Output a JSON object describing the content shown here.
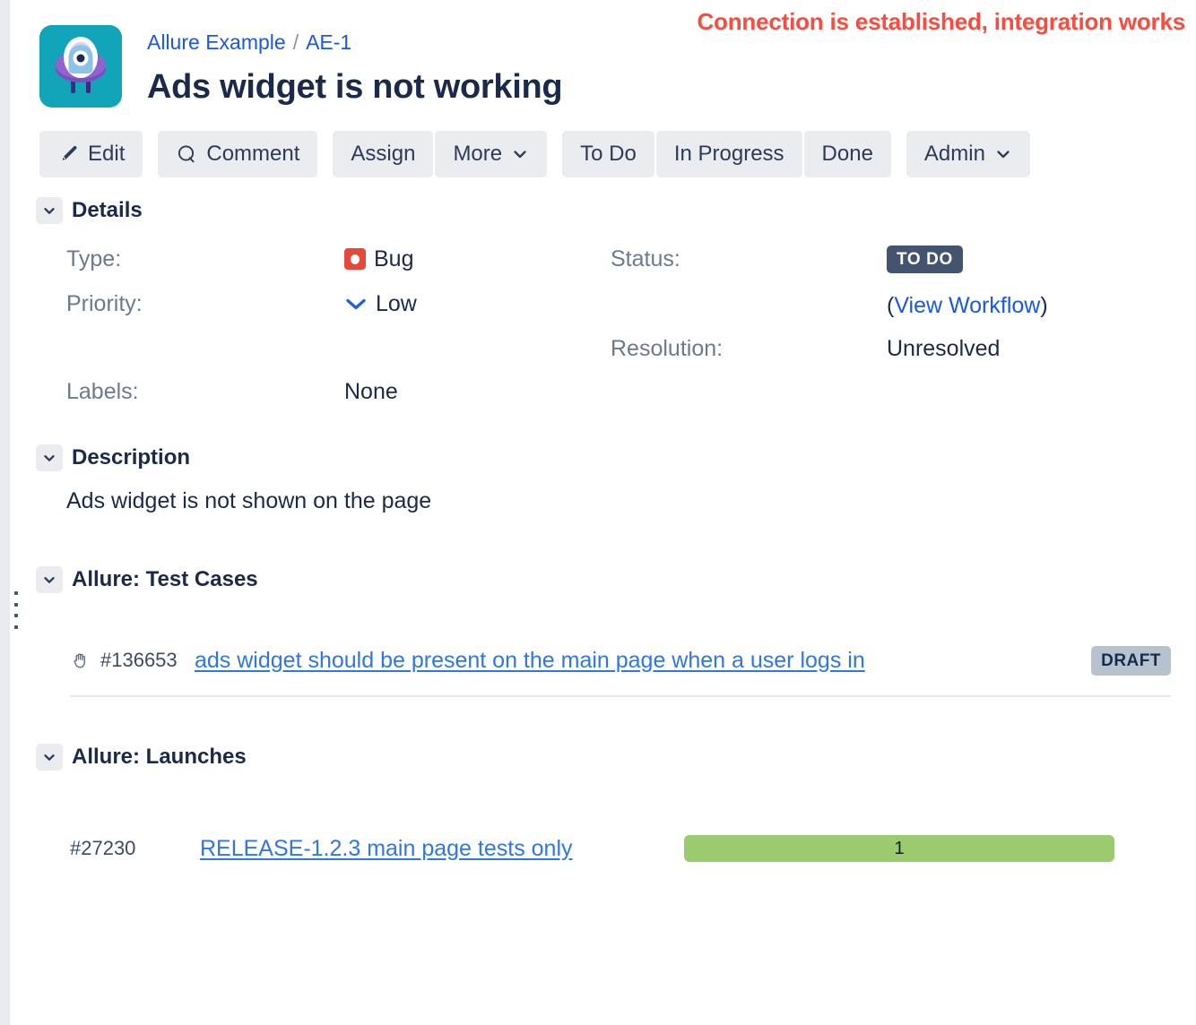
{
  "annotation": {
    "text": "Connection is established, integration works",
    "color": "#fb4b3e"
  },
  "header": {
    "logo_icon": "allure-ufo-logo",
    "breadcrumb": {
      "project": "Allure Example",
      "separator": "/",
      "issue_key": "AE-1"
    },
    "title": "Ads widget is not working"
  },
  "toolbar": {
    "edit_label": "Edit",
    "edit_icon": "pencil-icon",
    "comment_label": "Comment",
    "comment_icon": "comment-bubble-icon",
    "assign_label": "Assign",
    "more_label": "More",
    "more_icon": "chevron-down-icon",
    "todo_label": "To Do",
    "inprogress_label": "In Progress",
    "done_label": "Done",
    "admin_label": "Admin",
    "admin_icon": "chevron-down-icon"
  },
  "details": {
    "section_title": "Details",
    "collapse_icon": "chevron-down-icon",
    "type_label": "Type:",
    "type_value": "Bug",
    "type_icon": "bug-icon",
    "priority_label": "Priority:",
    "priority_value": "Low",
    "priority_icon": "priority-low-icon",
    "labels_label": "Labels:",
    "labels_value": "None",
    "status_label": "Status:",
    "status_value": "TO DO",
    "workflow_open_paren": "(",
    "workflow_link": "View Workflow",
    "workflow_close_paren": ")",
    "resolution_label": "Resolution:",
    "resolution_value": "Unresolved"
  },
  "description": {
    "section_title": "Description",
    "collapse_icon": "chevron-down-icon",
    "body": "Ads widget is not shown on the page"
  },
  "test_cases": {
    "section_title": "Allure: Test Cases",
    "collapse_icon": "chevron-down-icon",
    "rows": [
      {
        "icon": "hand-icon",
        "id": "#136653",
        "name": "ads widget should be present on the main page when a user logs in",
        "status": "DRAFT"
      }
    ]
  },
  "launches": {
    "section_title": "Allure: Launches",
    "collapse_icon": "chevron-down-icon",
    "rows": [
      {
        "id": "#27230",
        "name": "RELEASE-1.2.3 main page tests only",
        "bar_value": "1",
        "bar_color": "#9bcb6e"
      }
    ]
  }
}
